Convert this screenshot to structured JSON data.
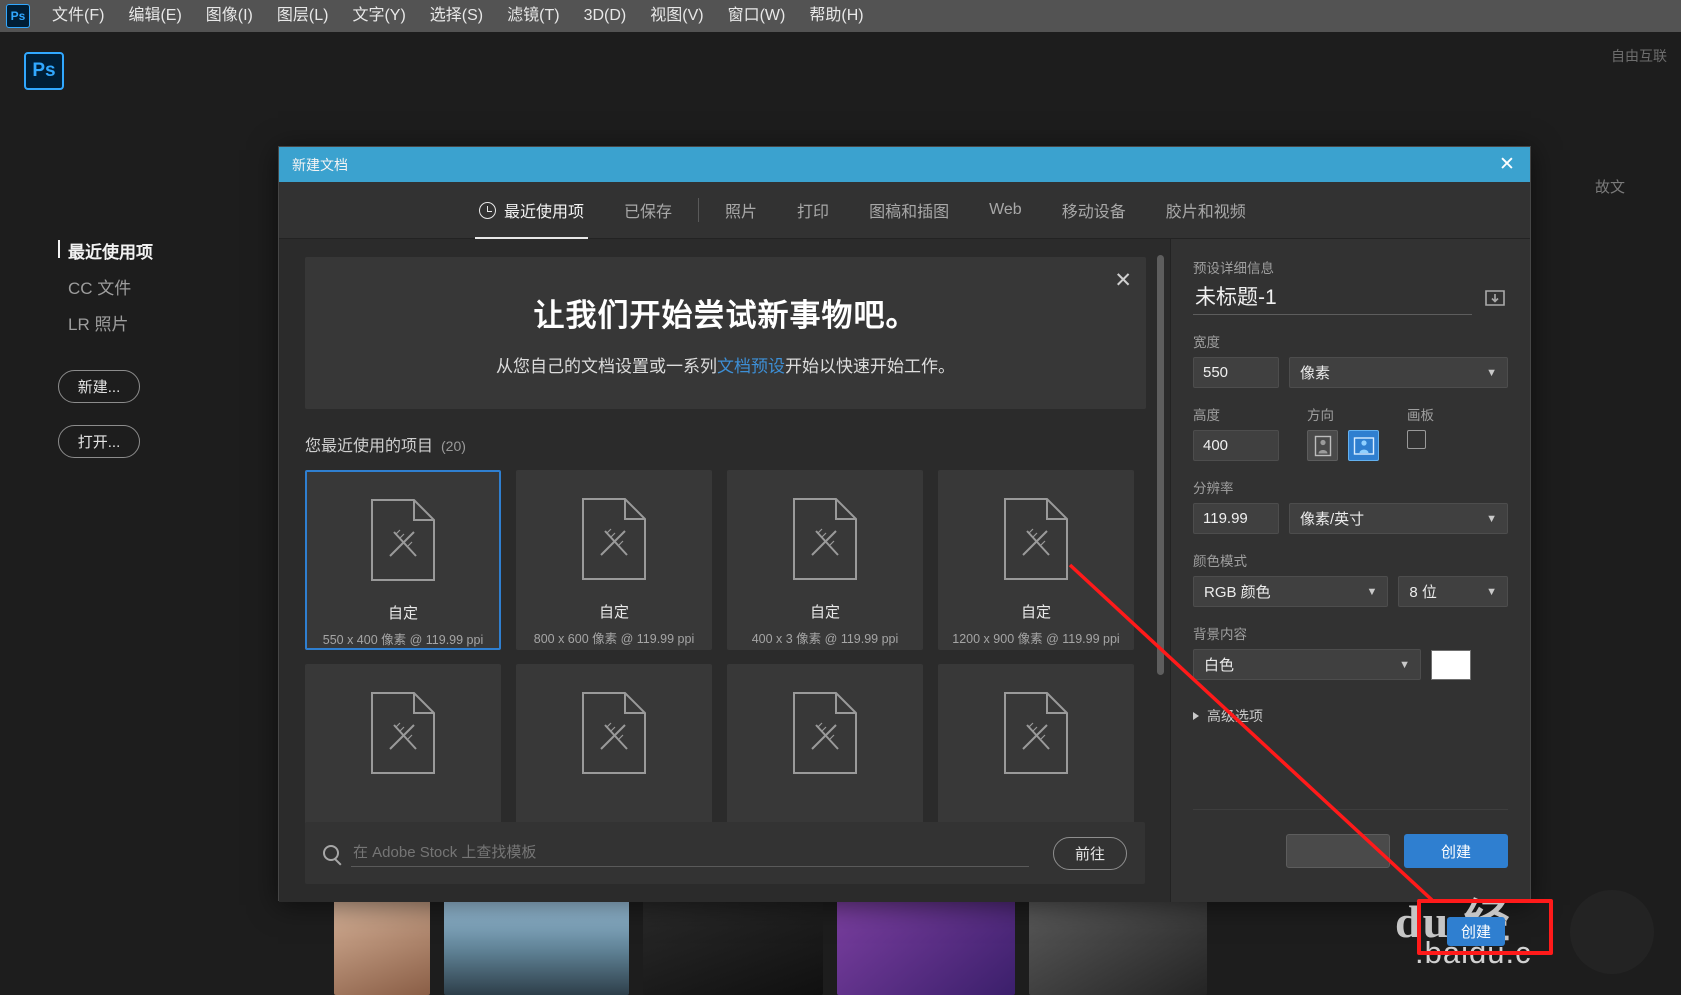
{
  "menubar": {
    "logo": "Ps",
    "items": [
      "文件(F)",
      "编辑(E)",
      "图像(I)",
      "图层(L)",
      "文字(Y)",
      "选择(S)",
      "滤镜(T)",
      "3D(D)",
      "视图(V)",
      "窗口(W)",
      "帮助(H)"
    ]
  },
  "start_workspace": {
    "logo": "Ps",
    "nav": [
      {
        "label": "最近使用项",
        "active": true
      },
      {
        "label": "CC 文件",
        "active": false
      },
      {
        "label": "LR 照片",
        "active": false
      }
    ],
    "new_button": "新建...",
    "open_button": "打开...",
    "side_text": "故文"
  },
  "dialog": {
    "title": "新建文档",
    "close_icon": "close-icon",
    "tabs": [
      {
        "label": "最近使用项",
        "icon": "clock-icon",
        "active": true
      },
      {
        "label": "已保存",
        "icon": "",
        "active": false
      },
      {
        "label": "照片",
        "icon": "",
        "active": false
      },
      {
        "label": "打印",
        "icon": "",
        "active": false
      },
      {
        "label": "图稿和插图",
        "icon": "",
        "active": false
      },
      {
        "label": "Web",
        "icon": "",
        "active": false
      },
      {
        "label": "移动设备",
        "icon": "",
        "active": false
      },
      {
        "label": "胶片和视频",
        "icon": "",
        "active": false
      }
    ],
    "promo": {
      "close_icon": "close-icon",
      "headline": "让我们开始尝试新事物吧。",
      "sub_prefix": "从您自己的文档设置或一系列",
      "sub_link": "文档预设",
      "sub_suffix": "开始以快速开始工作。"
    },
    "recent": {
      "heading": "您最近使用的项目",
      "count": "(20)",
      "cards": [
        {
          "name": "自定",
          "dims": "550 x 400 像素 @ 119.99 ppi",
          "selected": true
        },
        {
          "name": "自定",
          "dims": "800 x 600 像素 @ 119.99 ppi",
          "selected": false
        },
        {
          "name": "自定",
          "dims": "400 x 3 像素 @ 119.99 ppi",
          "selected": false
        },
        {
          "name": "自定",
          "dims": "1200 x 900 像素 @ 119.99 ppi",
          "selected": false
        },
        {
          "name": "",
          "dims": "",
          "selected": false
        },
        {
          "name": "",
          "dims": "",
          "selected": false
        },
        {
          "name": "",
          "dims": "",
          "selected": false
        },
        {
          "name": "",
          "dims": "",
          "selected": false
        }
      ]
    },
    "stock": {
      "search_icon": "search-icon",
      "placeholder": "在 Adobe Stock 上查找模板",
      "value": "",
      "goto_label": "前往"
    },
    "preset": {
      "section_title": "预设详细信息",
      "doc_name": "未标题-1",
      "save_preset_icon": "save-preset-icon",
      "width_label": "宽度",
      "width_value": "550",
      "width_unit": "像素",
      "height_label": "高度",
      "height_value": "400",
      "orientation_label": "方向",
      "orientation_portrait_icon": "portrait-orientation-icon",
      "orientation_landscape_icon": "landscape-orientation-icon",
      "orientation_selected": "landscape",
      "artboard_label": "画板",
      "artboard_checked": false,
      "resolution_label": "分辨率",
      "resolution_value": "119.99",
      "resolution_unit": "像素/英寸",
      "color_mode_label": "颜色模式",
      "color_mode_value": "RGB 颜色",
      "bit_depth_value": "8 位",
      "background_label": "背景内容",
      "background_value": "白色",
      "background_swatch": "#ffffff",
      "advanced_label": "高级选项",
      "create_label": "创建"
    }
  },
  "annotation": {
    "accent_color": "#ff1a1a",
    "watermark_main": "du 经",
    "watermark_sub": ".baidu.c",
    "watermark_badge": "创建",
    "corner_text": "自由互联"
  },
  "colors": {
    "dialog_title_bar": "#3ba2cf",
    "accent_blue": "#2f7fd0",
    "link_blue": "#3d8fd6",
    "panel_bg": "#323232",
    "main_bg": "#2b2b2b",
    "card_bg": "#383838"
  }
}
